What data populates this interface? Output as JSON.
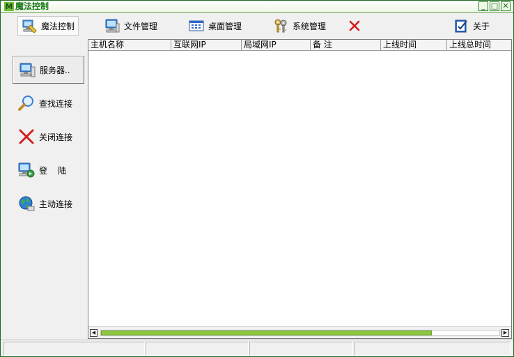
{
  "window": {
    "title": "魔法控制",
    "app_icon_letter": "M",
    "buttons": {
      "minimize": "_",
      "maximize": "□",
      "close": "✕"
    }
  },
  "toolbar": {
    "items": [
      {
        "label": "魔法控制",
        "icon": "magic-control-icon",
        "active": true
      },
      {
        "label": "文件管理",
        "icon": "computer-icon"
      },
      {
        "label": "桌面管理",
        "icon": "desktop-icon"
      },
      {
        "label": "系统管理",
        "icon": "keys-icon"
      },
      {
        "label": "",
        "icon": "red-x-icon"
      },
      {
        "label": "关于",
        "icon": "about-icon"
      }
    ]
  },
  "sidebar": {
    "items": [
      {
        "label": "服务器..",
        "icon": "server-computer-icon",
        "active": true
      },
      {
        "label": "查找连接",
        "icon": "magnifier-icon"
      },
      {
        "label": "关闭连接",
        "icon": "close-x-icon"
      },
      {
        "label": "登    陆",
        "icon": "login-computer-icon"
      },
      {
        "label": "主动连接",
        "icon": "globe-icon"
      }
    ]
  },
  "table": {
    "columns": [
      "主机名称",
      "互联网IP",
      "局域网IP",
      "备 注",
      "上线时间",
      "上线总时间"
    ],
    "rows": []
  },
  "scrollbar": {
    "thumb_fraction": 0.83,
    "left_arrow": "◀",
    "right_arrow": "▶"
  },
  "statusbar": {
    "panes": [
      "",
      "",
      "",
      ""
    ]
  },
  "colors": {
    "accent": "#1a7a1a",
    "scroll_thumb": "#8dc63f",
    "red": "#d42020"
  }
}
